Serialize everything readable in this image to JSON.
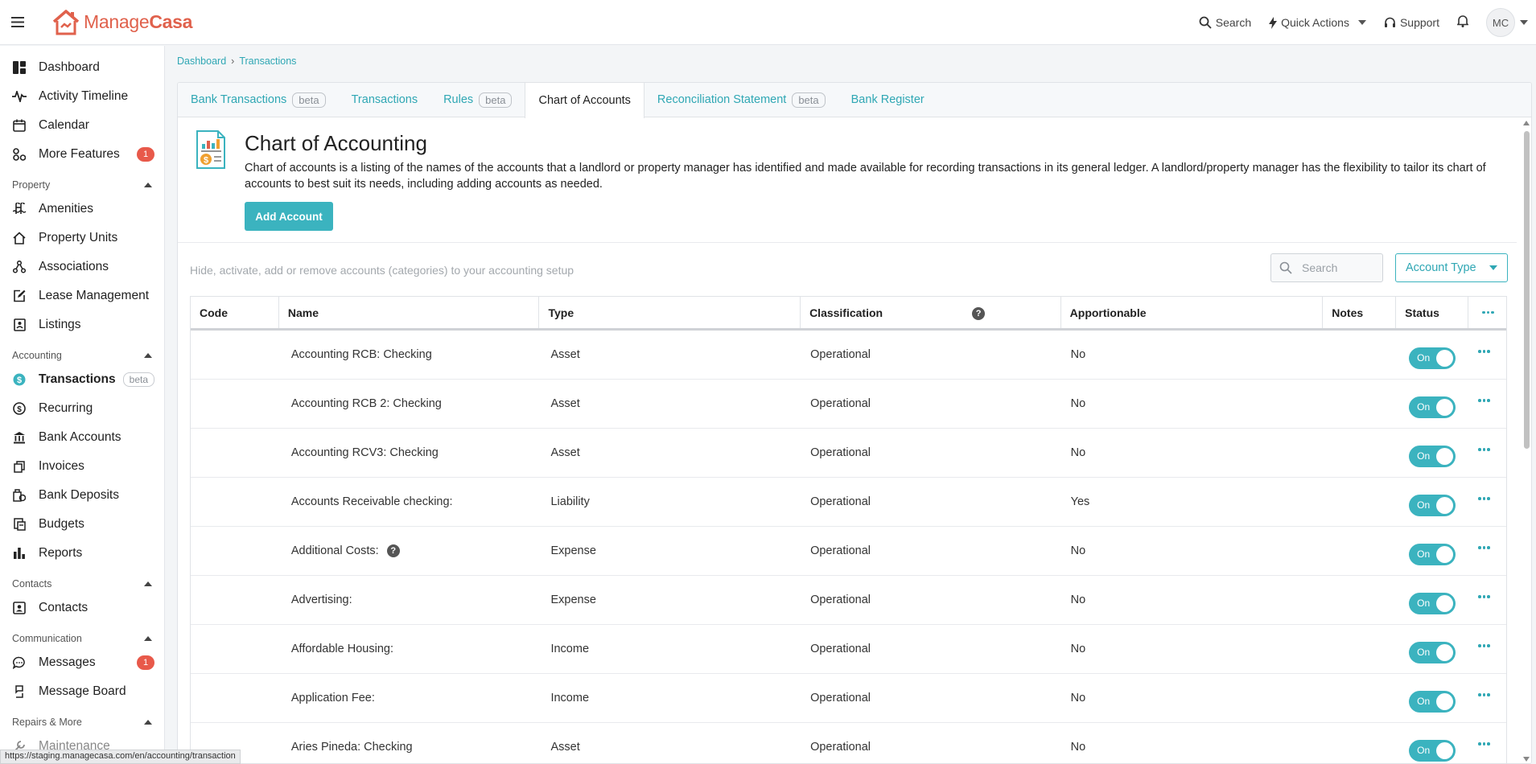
{
  "topbar": {
    "logo_plain": "Manage",
    "logo_bold": "Casa",
    "search": "Search",
    "quick_actions": "Quick Actions",
    "support": "Support",
    "avatar": "MC"
  },
  "sidebar": {
    "top_items": [
      {
        "label": "Dashboard",
        "icon": "dashboard-icon"
      },
      {
        "label": "Activity Timeline",
        "icon": "activity-icon"
      },
      {
        "label": "Calendar",
        "icon": "calendar-icon"
      },
      {
        "label": "More Features",
        "icon": "features-icon",
        "badge": "1"
      }
    ],
    "property": {
      "title": "Property",
      "items": [
        {
          "label": "Amenities",
          "icon": "amenities-icon"
        },
        {
          "label": "Property Units",
          "icon": "home-icon"
        },
        {
          "label": "Associations",
          "icon": "associations-icon"
        },
        {
          "label": "Lease Management",
          "icon": "lease-icon"
        },
        {
          "label": "Listings",
          "icon": "listings-icon"
        }
      ]
    },
    "accounting": {
      "title": "Accounting",
      "items": [
        {
          "label": "Transactions",
          "icon": "dollar-circle-icon",
          "beta": "beta"
        },
        {
          "label": "Recurring",
          "icon": "recurring-icon"
        },
        {
          "label": "Bank Accounts",
          "icon": "bank-icon"
        },
        {
          "label": "Invoices",
          "icon": "invoices-icon"
        },
        {
          "label": "Bank Deposits",
          "icon": "deposits-icon"
        },
        {
          "label": "Budgets",
          "icon": "budgets-icon"
        },
        {
          "label": "Reports",
          "icon": "reports-icon"
        }
      ]
    },
    "contacts": {
      "title": "Contacts",
      "items": [
        {
          "label": "Contacts",
          "icon": "contacts-icon"
        }
      ]
    },
    "communication": {
      "title": "Communication",
      "items": [
        {
          "label": "Messages",
          "icon": "messages-icon",
          "badge": "1"
        },
        {
          "label": "Message Board",
          "icon": "message-board-icon"
        }
      ]
    },
    "repairs": {
      "title": "Repairs & More",
      "partial": "Maintenance"
    }
  },
  "status_url": "https://staging.managecasa.com/en/accounting/transaction",
  "breadcrumb": [
    "Dashboard",
    "Transactions"
  ],
  "tabs": [
    {
      "label": "Bank Transactions",
      "beta": "beta"
    },
    {
      "label": "Transactions",
      "beta": ""
    },
    {
      "label": "Rules",
      "beta": "beta"
    },
    {
      "label": "Chart of Accounts",
      "beta": "",
      "active": true
    },
    {
      "label": "Reconciliation Statement",
      "beta": "beta"
    },
    {
      "label": "Bank Register",
      "beta": ""
    }
  ],
  "header": {
    "title": "Chart of Accounting",
    "description": "Chart of accounts is a listing of the names of the accounts that a landlord or property manager has identified and made available for recording transactions in its general ledger. A landlord/property manager has the flexibility to tailor its chart of accounts to best suit its needs, including adding accounts as needed.",
    "add_button": "Add Account"
  },
  "filters": {
    "hint": "Hide, activate, add or remove accounts (categories) to your accounting setup",
    "search_placeholder": "Search",
    "account_type": "Account Type"
  },
  "table": {
    "columns": [
      "Code",
      "Name",
      "Type",
      "Classification",
      "Apportionable",
      "Notes",
      "Status"
    ],
    "rows": [
      {
        "code": "",
        "name": "Accounting RCB: Checking",
        "type": "Asset",
        "classification": "Operational",
        "apportionable": "No",
        "notes": "",
        "status": "On"
      },
      {
        "code": "",
        "name": "Accounting RCB 2: Checking",
        "type": "Asset",
        "classification": "Operational",
        "apportionable": "No",
        "notes": "",
        "status": "On"
      },
      {
        "code": "",
        "name": "Accounting RCV3: Checking",
        "type": "Asset",
        "classification": "Operational",
        "apportionable": "No",
        "notes": "",
        "status": "On"
      },
      {
        "code": "",
        "name": "Accounts Receivable checking:",
        "type": "Liability",
        "classification": "Operational",
        "apportionable": "Yes",
        "notes": "",
        "status": "On"
      },
      {
        "code": "",
        "name": "Additional Costs:",
        "type": "Expense",
        "classification": "Operational",
        "apportionable": "No",
        "notes": "",
        "status": "On",
        "help": "?"
      },
      {
        "code": "",
        "name": "Advertising:",
        "type": "Expense",
        "classification": "Operational",
        "apportionable": "No",
        "notes": "",
        "status": "On"
      },
      {
        "code": "",
        "name": "Affordable Housing:",
        "type": "Income",
        "classification": "Operational",
        "apportionable": "No",
        "notes": "",
        "status": "On"
      },
      {
        "code": "",
        "name": "Application Fee:",
        "type": "Income",
        "classification": "Operational",
        "apportionable": "No",
        "notes": "",
        "status": "On"
      },
      {
        "code": "",
        "name": "Aries Pineda: Checking",
        "type": "Asset",
        "classification": "Operational",
        "apportionable": "No",
        "notes": "",
        "status": "On"
      }
    ]
  },
  "colors": {
    "accent": "#3bb3bf",
    "brand": "#e0614c",
    "badge": "#e8594a"
  }
}
